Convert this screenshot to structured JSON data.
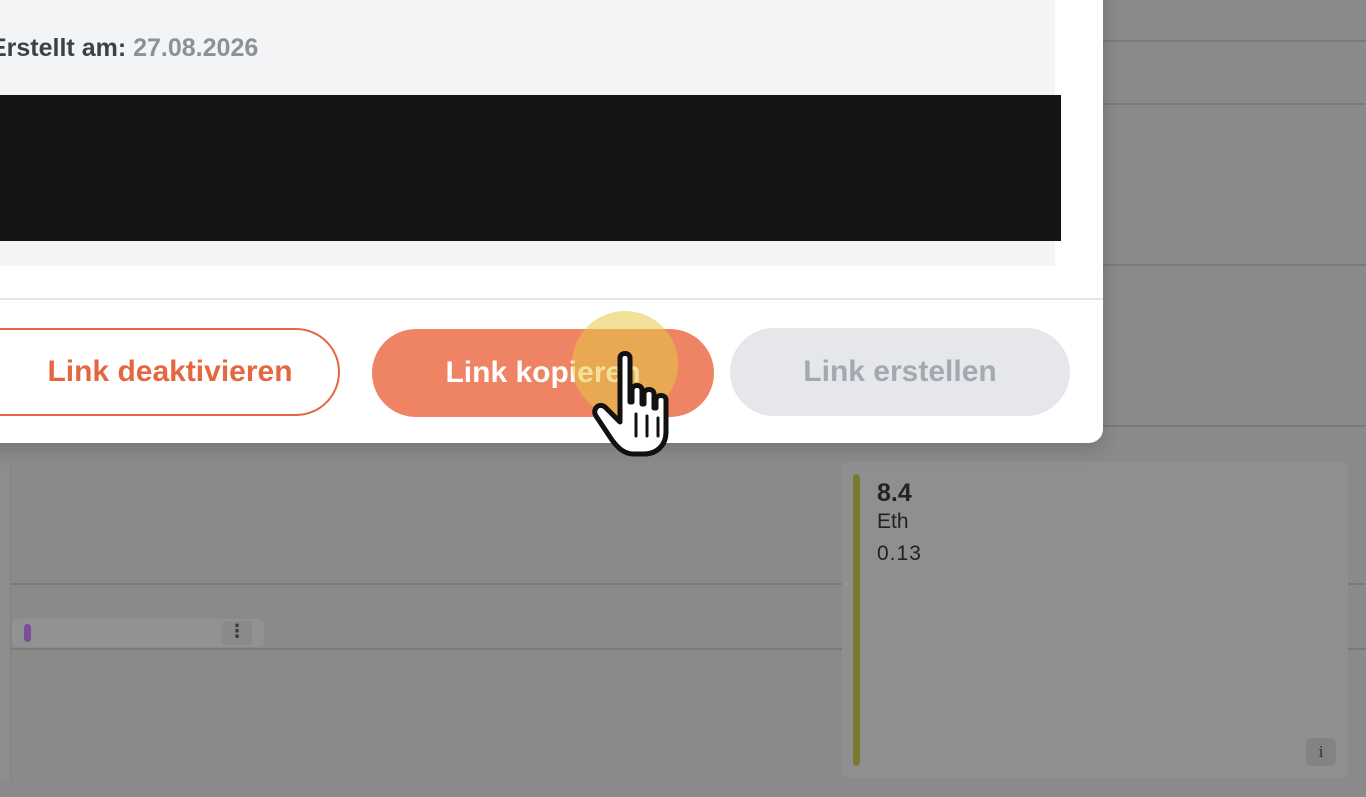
{
  "modal": {
    "created_label": "Erstellt am:",
    "created_date": "27.08.2026",
    "buttons": {
      "deactivate": "Link deaktivieren",
      "copy": "Link kopieren",
      "create": "Link erstellen"
    }
  },
  "background": {
    "card": {
      "value": "8.4",
      "label": "Eth",
      "sub_value": "0.13",
      "info_icon": "i"
    },
    "event_more_icon": "⋮"
  },
  "colors": {
    "accent": "#e5673f",
    "accent_fill": "#ee8464",
    "disabled_bg": "#e6e7ea",
    "disabled_text": "#a4a8b0"
  },
  "icons": {
    "cursor": "hand-pointer-icon",
    "more": "vertical-ellipsis-icon",
    "info": "info-icon"
  }
}
